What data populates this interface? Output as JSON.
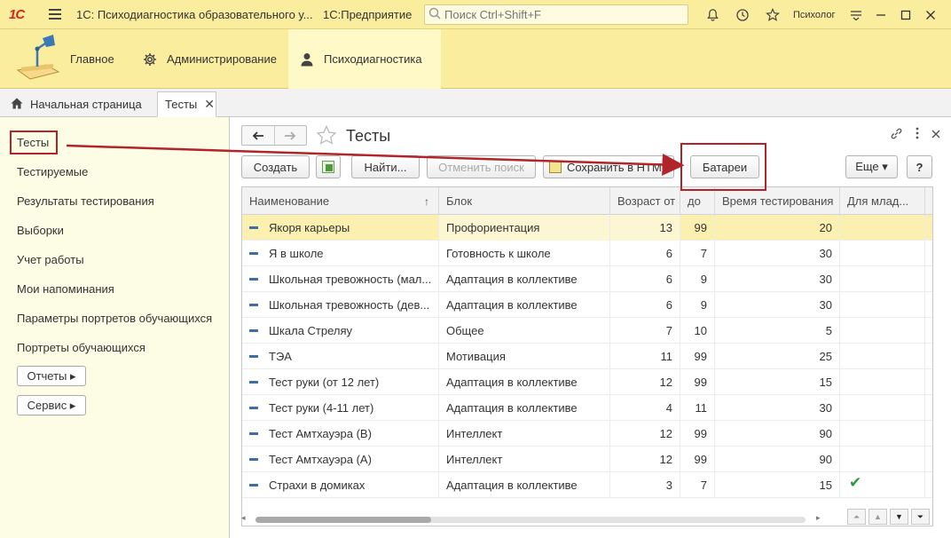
{
  "titlebar": {
    "logo": "1С",
    "app_title": "1С: Психодиагностика образовательного у...",
    "platform": "1С:Предприятие",
    "search_placeholder": "Поиск Ctrl+Shift+F",
    "username": "Психолог"
  },
  "sections": [
    {
      "label": "Главное",
      "icon": "desk-lamp-icon"
    },
    {
      "label": "Администрирование",
      "icon": "gear-icon"
    },
    {
      "label": "Психодиагностика",
      "icon": "user-icon"
    }
  ],
  "tabs": {
    "home": "Начальная страница",
    "current": "Тесты"
  },
  "leftnav": {
    "items": [
      "Тесты",
      "Тестируемые",
      "Результаты тестирования",
      "Выборки",
      "Учет работы",
      "Мои напоминания",
      "Параметры портретов обучающихся",
      "Портреты обучающихся"
    ],
    "reports_button": "Отчеты ▸",
    "service_button": "Сервис ▸"
  },
  "form": {
    "title": "Тесты",
    "buttons": {
      "create": "Создать",
      "find": "Найти...",
      "cancel_search": "Отменить поиск",
      "save_html": "Сохранить в HTML",
      "batteries": "Батареи",
      "more": "Еще ▾",
      "help": "?"
    }
  },
  "table": {
    "columns": [
      "Наименование",
      "Блок",
      "Возраст от",
      "до",
      "Время тестирования",
      "Для млад..."
    ],
    "rows": [
      {
        "name": "Якоря карьеры",
        "block": "Профориентация",
        "from": "13",
        "to": "99",
        "time": "20",
        "young": ""
      },
      {
        "name": "Я в школе",
        "block": "Готовность к школе",
        "from": "6",
        "to": "7",
        "time": "30",
        "young": ""
      },
      {
        "name": "Школьная тревожность (мал...",
        "block": "Адаптация в коллективе",
        "from": "6",
        "to": "9",
        "time": "30",
        "young": ""
      },
      {
        "name": "Школьная тревожность (дев...",
        "block": "Адаптация в коллективе",
        "from": "6",
        "to": "9",
        "time": "30",
        "young": ""
      },
      {
        "name": "Шкала Стреляу",
        "block": "Общее",
        "from": "7",
        "to": "10",
        "time": "5",
        "young": ""
      },
      {
        "name": "ТЭА",
        "block": "Мотивация",
        "from": "11",
        "to": "99",
        "time": "25",
        "young": ""
      },
      {
        "name": "Тест руки (от 12 лет)",
        "block": "Адаптация в коллективе",
        "from": "12",
        "to": "99",
        "time": "15",
        "young": ""
      },
      {
        "name": "Тест руки (4-11 лет)",
        "block": "Адаптация в коллективе",
        "from": "4",
        "to": "11",
        "time": "30",
        "young": ""
      },
      {
        "name": "Тест Амтхауэра (В)",
        "block": "Интеллект",
        "from": "12",
        "to": "99",
        "time": "90",
        "young": ""
      },
      {
        "name": "Тест Амтхауэра (А)",
        "block": "Интеллект",
        "from": "12",
        "to": "99",
        "time": "90",
        "young": ""
      },
      {
        "name": "Страхи в домиках",
        "block": "Адаптация в коллективе",
        "from": "3",
        "to": "7",
        "time": "15",
        "young": "✔"
      }
    ]
  }
}
